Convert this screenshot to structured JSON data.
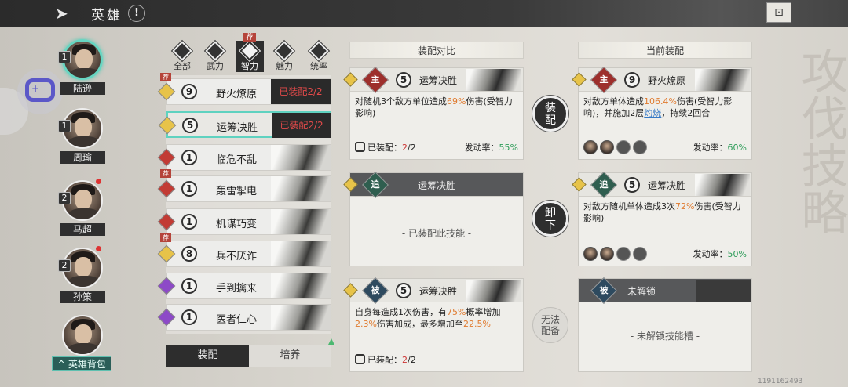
{
  "header": {
    "title": "英雄",
    "info": "!",
    "back": "➤",
    "corner": "⊡"
  },
  "watermark": "攻伐技略",
  "watermark_id": "1191162493",
  "heroes": [
    {
      "name": "陆逊",
      "level": "1",
      "selected": true
    },
    {
      "name": "周瑜",
      "level": "1",
      "selected": false
    },
    {
      "name": "马超",
      "level": "2",
      "selected": false
    },
    {
      "name": "孙策",
      "level": "2",
      "selected": false
    },
    {
      "name": "",
      "level": "",
      "selected": false
    }
  ],
  "hero_bag": "^ 英雄背包",
  "filter_tabs": [
    {
      "label": "全部"
    },
    {
      "label": "武力"
    },
    {
      "label": "智力",
      "selected": true
    },
    {
      "label": "魅力"
    },
    {
      "label": "统率"
    }
  ],
  "rec_tag": "荐",
  "skills": [
    {
      "num": "9",
      "name": "野火燎原",
      "quality": "gold",
      "status": "已装配2/2",
      "rec": true
    },
    {
      "num": "5",
      "name": "运筹决胜",
      "quality": "gold",
      "status": "已装配2/2",
      "rec": false,
      "selected": true
    },
    {
      "num": "1",
      "name": "临危不乱",
      "quality": "red",
      "status": "",
      "rec": false
    },
    {
      "num": "1",
      "name": "轰雷掣电",
      "quality": "red",
      "status": "",
      "rec": true
    },
    {
      "num": "1",
      "name": "机谋巧变",
      "quality": "red",
      "status": "",
      "rec": false
    },
    {
      "num": "8",
      "name": "兵不厌诈",
      "quality": "gold",
      "status": "",
      "rec": true
    },
    {
      "num": "1",
      "name": "手到擒来",
      "quality": "purple",
      "status": "",
      "rec": false
    },
    {
      "num": "1",
      "name": "医者仁心",
      "quality": "purple",
      "status": "",
      "rec": false
    }
  ],
  "bottom_tabs": {
    "equip": "装配",
    "train": "培养"
  },
  "compare": {
    "header": "装配对比",
    "card1": {
      "type": "主",
      "num": "5",
      "name": "运筹决胜",
      "desc_a": "对随机3个敌方单位造成",
      "desc_pct": "69%",
      "desc_b": "伤害(受智力影响)",
      "equipped_label": "已装配：",
      "equipped_cur": "2",
      "equipped_total": "/2",
      "rate_label": "发动率：",
      "rate": "55%"
    },
    "card2": {
      "type": "追",
      "name": "运筹决胜",
      "empty": "- 已装配此技能 -"
    },
    "card3": {
      "type": "被",
      "num": "5",
      "name": "运筹决胜",
      "desc_a": "自身每造成1次伤害，有",
      "desc_p1": "75%",
      "desc_b": "概率增加",
      "desc_p2": "2.3%",
      "desc_c": "伤害加成，最多增加至",
      "desc_p3": "22.5%",
      "equipped_label": "已装配：",
      "equipped_cur": "2",
      "equipped_total": "/2"
    }
  },
  "actions": {
    "equip": "装\n配",
    "unequip": "卸\n下",
    "cannot": "无法\n配备"
  },
  "current": {
    "header": "当前装配",
    "card1": {
      "type": "主",
      "num": "9",
      "name": "野火燎原",
      "desc_a": "对敌方单体造成",
      "desc_pct": "106.4%",
      "desc_b": "伤害(受智力影响)，并施加2层",
      "desc_link": "灼烧",
      "desc_c": "，持续2回合",
      "rate_label": "发动率：",
      "rate": "60%"
    },
    "card2": {
      "type": "追",
      "num": "5",
      "name": "运筹决胜",
      "desc_a": "对敌方随机单体造成3次",
      "desc_pct": "72%",
      "desc_b": "伤害(受智力影响)",
      "rate_label": "发动率：",
      "rate": "50%"
    },
    "card3": {
      "type": "被",
      "name": "未解锁",
      "empty": "- 未解锁技能槽 -"
    }
  }
}
